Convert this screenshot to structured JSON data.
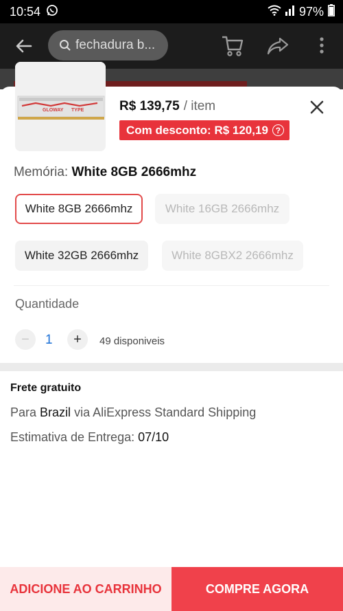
{
  "status_bar": {
    "time": "10:54",
    "battery": "97%"
  },
  "header": {
    "search_text": "fechadura b..."
  },
  "product": {
    "price": "R$ 139,75",
    "price_unit": "/ item",
    "discount_label": "Com desconto: R$ 120,19",
    "brand_text": "GLOWAY",
    "series_text": "TYPE"
  },
  "variant": {
    "label": "Memória:",
    "selected_value": "White 8GB 2666mhz",
    "options": [
      {
        "label": "White 8GB 2666mhz"
      },
      {
        "label": "White 16GB 2666mhz"
      },
      {
        "label": "White 32GB 2666mhz"
      },
      {
        "label": "White 8GBX2 2666mhz"
      }
    ]
  },
  "quantity": {
    "label": "Quantidade",
    "value": "1",
    "minus": "−",
    "plus": "+",
    "available": "49 disponiveis"
  },
  "shipping": {
    "title": "Frete gratuito",
    "line1_prefix": "Para",
    "line1_country": "Brazil",
    "line1_suffix": "via AliExpress Standard Shipping",
    "line2_prefix": "Estimativa de Entrega:",
    "line2_date": "07/10"
  },
  "footer": {
    "add_to_cart": "ADICIONE AO CARRINHO",
    "buy_now": "COMPRE AGORA"
  },
  "colors": {
    "accent": "#e8333b",
    "buy_now_bg": "#f0414b",
    "add_cart_bg": "#fdeaea",
    "quantity_value": "#1a6fd6"
  },
  "icons": [
    "whatsapp-icon",
    "wifi-icon",
    "signal-icon",
    "battery-icon",
    "back-arrow-icon",
    "search-icon",
    "cart-icon",
    "share-icon",
    "more-icon",
    "close-icon",
    "help-icon"
  ]
}
